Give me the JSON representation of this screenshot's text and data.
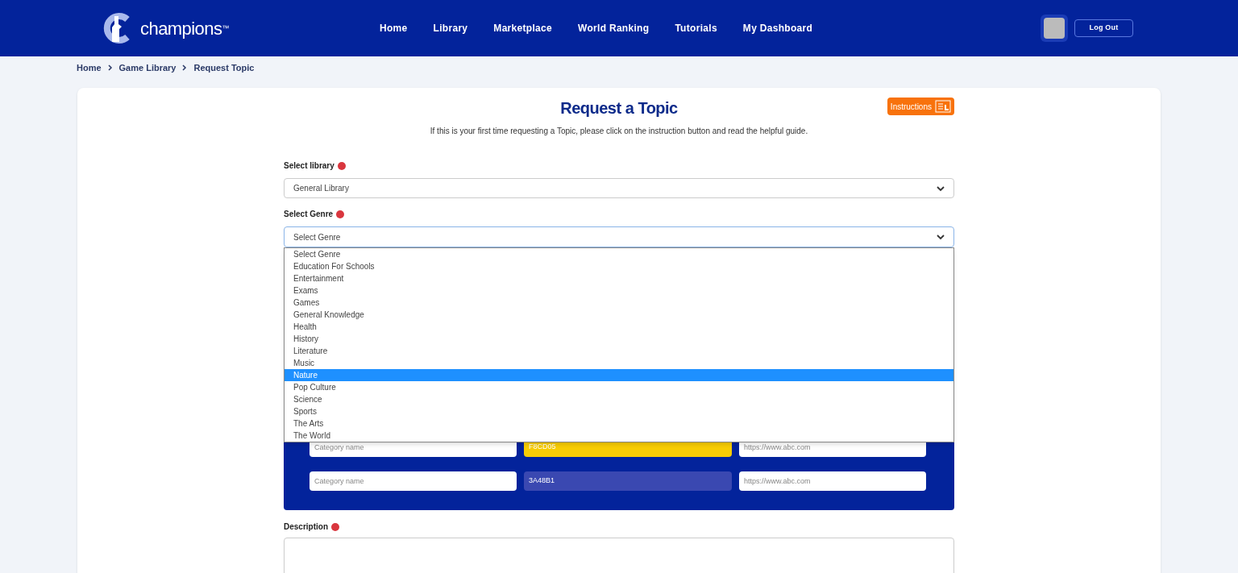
{
  "header": {
    "logo_text": "champions",
    "logo_mark": "™",
    "nav": [
      {
        "label": "Home"
      },
      {
        "label": "Library"
      },
      {
        "label": "Marketplace"
      },
      {
        "label": "World Ranking"
      },
      {
        "label": "Tutorials"
      },
      {
        "label": "My Dashboard"
      }
    ],
    "logout": "Log Out"
  },
  "breadcrumb": [
    "Home",
    "Game Library",
    "Request Topic"
  ],
  "title": "Request a Topic",
  "instructions_button": "Instructions",
  "intro": "If this is your first time requesting a Topic, please click on the instruction button and read the helpful guide.",
  "library": {
    "label": "Select library",
    "value": "General Library"
  },
  "genre": {
    "label": "Select Genre",
    "value": "Select Genre",
    "expanded": true,
    "options": [
      {
        "label": "Select Genre",
        "highlighted": false
      },
      {
        "label": "Education For Schools",
        "highlighted": false
      },
      {
        "label": "Entertainment",
        "highlighted": false
      },
      {
        "label": "Exams",
        "highlighted": false
      },
      {
        "label": "Games",
        "highlighted": false
      },
      {
        "label": "General Knowledge",
        "highlighted": false
      },
      {
        "label": "Health",
        "highlighted": false
      },
      {
        "label": "History",
        "highlighted": false
      },
      {
        "label": "Literature",
        "highlighted": false
      },
      {
        "label": "Music",
        "highlighted": false
      },
      {
        "label": "Nature",
        "highlighted": true
      },
      {
        "label": "Pop Culture",
        "highlighted": false
      },
      {
        "label": "Science",
        "highlighted": false
      },
      {
        "label": "Sports",
        "highlighted": false
      },
      {
        "label": "The Arts",
        "highlighted": false
      },
      {
        "label": "The World",
        "highlighted": false
      }
    ]
  },
  "categories": [
    {
      "name_placeholder": "Category name",
      "color": "#f8cd05",
      "color_value": "F8CD05",
      "url_placeholder": "https://www.abc.com"
    },
    {
      "name_placeholder": "Category name",
      "color": "#3a48b1",
      "color_value": "3A48B1",
      "url_placeholder": "https://www.abc.com"
    }
  ],
  "description": {
    "label": "Description"
  }
}
